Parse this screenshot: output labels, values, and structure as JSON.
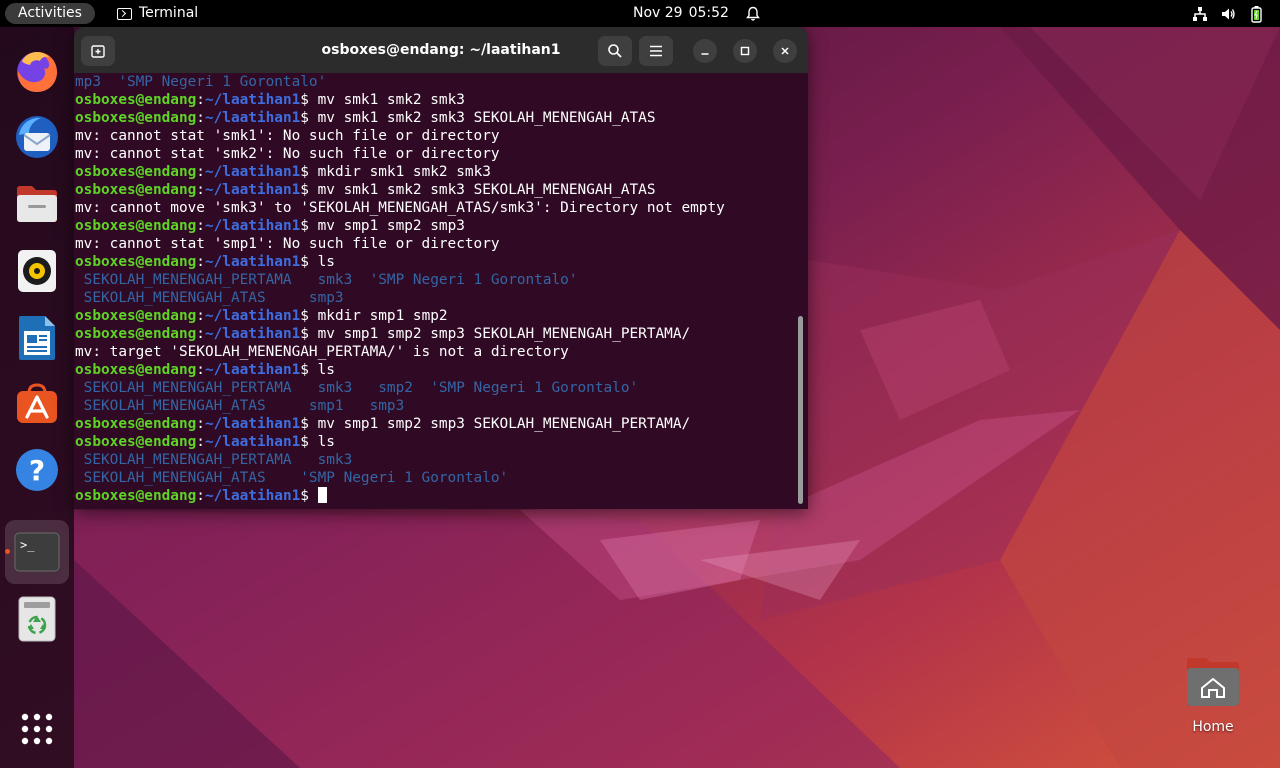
{
  "topbar": {
    "activities_label": "Activities",
    "app_label": "Terminal",
    "date": "Nov 29",
    "time": "05:52",
    "icons": [
      "alarm-bell-icon",
      "network-icon",
      "volume-icon",
      "battery-icon"
    ]
  },
  "dock": {
    "apps": [
      "Firefox",
      "Thunderbird",
      "Files",
      "Rhythmbox",
      "LibreOffice Writer",
      "Ubuntu Software",
      "Help",
      "Terminal",
      "Trash",
      "Show Applications"
    ],
    "accent_color": "#e95420"
  },
  "desktop": {
    "home_label": "Home"
  },
  "terminal": {
    "title": "osboxes@endang: ~/laatihan1",
    "user": "osboxes@endang",
    "path": "~/laatihan1",
    "colors": {
      "background": "#300a24",
      "user": "#5fd427",
      "path": "#3e6de0",
      "dir": "#3465a4"
    },
    "lines": [
      {
        "kind": "out",
        "text": "mp3  'SMP Negeri 1 Gorontalo'",
        "dirs": true
      },
      {
        "kind": "prompt",
        "cmd": " mv smk1 smk2 smk3"
      },
      {
        "kind": "prompt",
        "cmd": " mv smk1 smk2 smk3 SEKOLAH_MENENGAH_ATAS"
      },
      {
        "kind": "out",
        "text": "mv: cannot stat 'smk1': No such file or directory"
      },
      {
        "kind": "out",
        "text": "mv: cannot stat 'smk2': No such file or directory"
      },
      {
        "kind": "prompt",
        "cmd": " mkdir smk1 smk2 smk3"
      },
      {
        "kind": "prompt",
        "cmd": " mv smk1 smk2 smk3 SEKOLAH_MENENGAH_ATAS"
      },
      {
        "kind": "out",
        "text": "mv: cannot move 'smk3' to 'SEKOLAH_MENENGAH_ATAS/smk3': Directory not empty"
      },
      {
        "kind": "prompt",
        "cmd": " mv smp1 smp2 smp3"
      },
      {
        "kind": "out",
        "text": "mv: cannot stat 'smp1': No such file or directory"
      },
      {
        "kind": "prompt",
        "cmd": " ls"
      },
      {
        "kind": "out",
        "text": " SEKOLAH_MENENGAH_PERTAMA   smk3  'SMP Negeri 1 Gorontalo'",
        "dirs": true
      },
      {
        "kind": "out",
        "text": " SEKOLAH_MENENGAH_ATAS     smp3",
        "dirs": true
      },
      {
        "kind": "prompt",
        "cmd": " mkdir smp1 smp2"
      },
      {
        "kind": "prompt",
        "cmd": " mv smp1 smp2 smp3 SEKOLAH_MENENGAH_PERTAMA/"
      },
      {
        "kind": "out",
        "text": "mv: target 'SEKOLAH_MENENGAH_PERTAMA/' is not a directory"
      },
      {
        "kind": "prompt",
        "cmd": " ls"
      },
      {
        "kind": "out",
        "text": " SEKOLAH_MENENGAH_PERTAMA   smk3   smp2  'SMP Negeri 1 Gorontalo'",
        "dirs": true
      },
      {
        "kind": "out",
        "text": " SEKOLAH_MENENGAH_ATAS     smp1   smp3",
        "dirs": true
      },
      {
        "kind": "prompt",
        "cmd": " mv smp1 smp2 smp3 SEKOLAH_MENENGAH_PERTAMA/"
      },
      {
        "kind": "prompt",
        "cmd": " ls"
      },
      {
        "kind": "out",
        "text": " SEKOLAH_MENENGAH_PERTAMA   smk3",
        "dirs": true
      },
      {
        "kind": "out",
        "text": " SEKOLAH_MENENGAH_ATAS    'SMP Negeri 1 Gorontalo'",
        "dirs": true
      },
      {
        "kind": "prompt",
        "cmd": " ",
        "cursor": true
      }
    ]
  }
}
